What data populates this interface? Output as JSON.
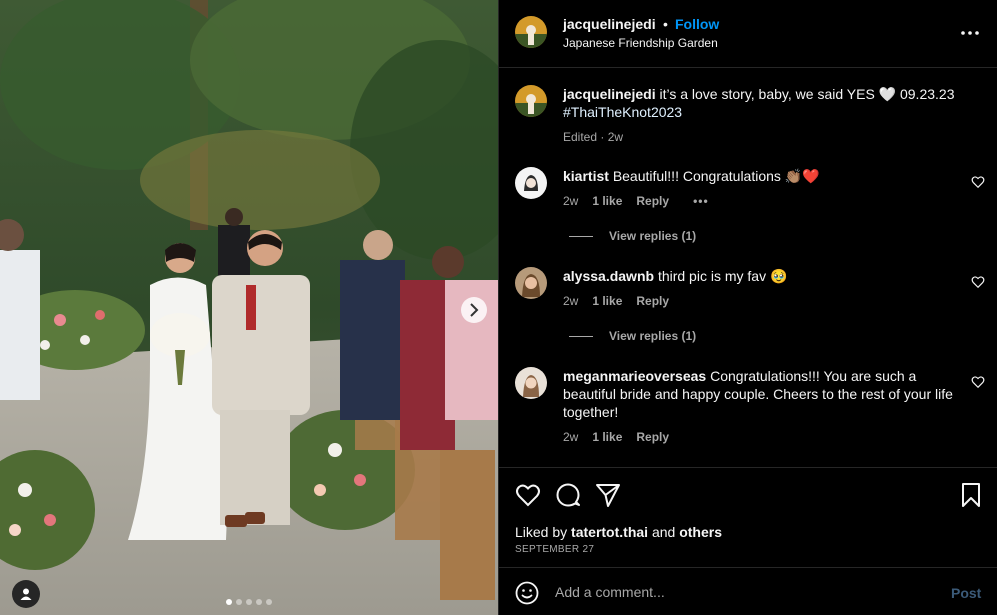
{
  "post": {
    "author": "jacquelinejedi",
    "separator": "•",
    "follow_label": "Follow",
    "location": "Japanese Friendship Garden"
  },
  "caption": {
    "username": "jacquelinejedi",
    "text": "it’s a love story, baby, we said YES 🤍 09.23.23",
    "hashtag": "#ThaiTheKnot2023",
    "edited": "Edited",
    "dot": "·",
    "age": "2w"
  },
  "comments": [
    {
      "username": "kiartist",
      "text": "Beautiful!!! Congratulations 👏🏽❤️",
      "age": "2w",
      "likes": "1 like",
      "reply_label": "Reply",
      "more": "•••",
      "view_replies": "View replies (1)"
    },
    {
      "username": "alyssa.dawnb",
      "text": "third pic is my fav 🥹",
      "age": "2w",
      "likes": "1 like",
      "reply_label": "Reply",
      "view_replies": "View replies (1)"
    },
    {
      "username": "meganmarieoverseas",
      "text": "Congratulations!!! You are such a beautiful bride and happy couple. Cheers to the rest of your life together!",
      "age": "2w",
      "likes": "1 like",
      "reply_label": "Reply"
    }
  ],
  "likes": {
    "prefix": "Liked by",
    "user": "tatertot.thai",
    "middle": "and",
    "others": "others"
  },
  "date": "SEPTEMBER 27",
  "comment_box": {
    "placeholder": "Add a comment...",
    "post_label": "Post"
  },
  "carousel": {
    "total": 5,
    "active": 1
  },
  "icons": {
    "more": "more-options-icon",
    "heart": "heart-icon",
    "comment": "comment-icon",
    "share": "share-icon",
    "save": "bookmark-icon",
    "emoji": "emoji-icon",
    "next": "chevron-right-icon",
    "tag": "user-tag-icon"
  },
  "colors": {
    "background": "#000000",
    "link_blue": "#0095f6",
    "muted": "#a8a8a8",
    "divider": "#262626"
  }
}
